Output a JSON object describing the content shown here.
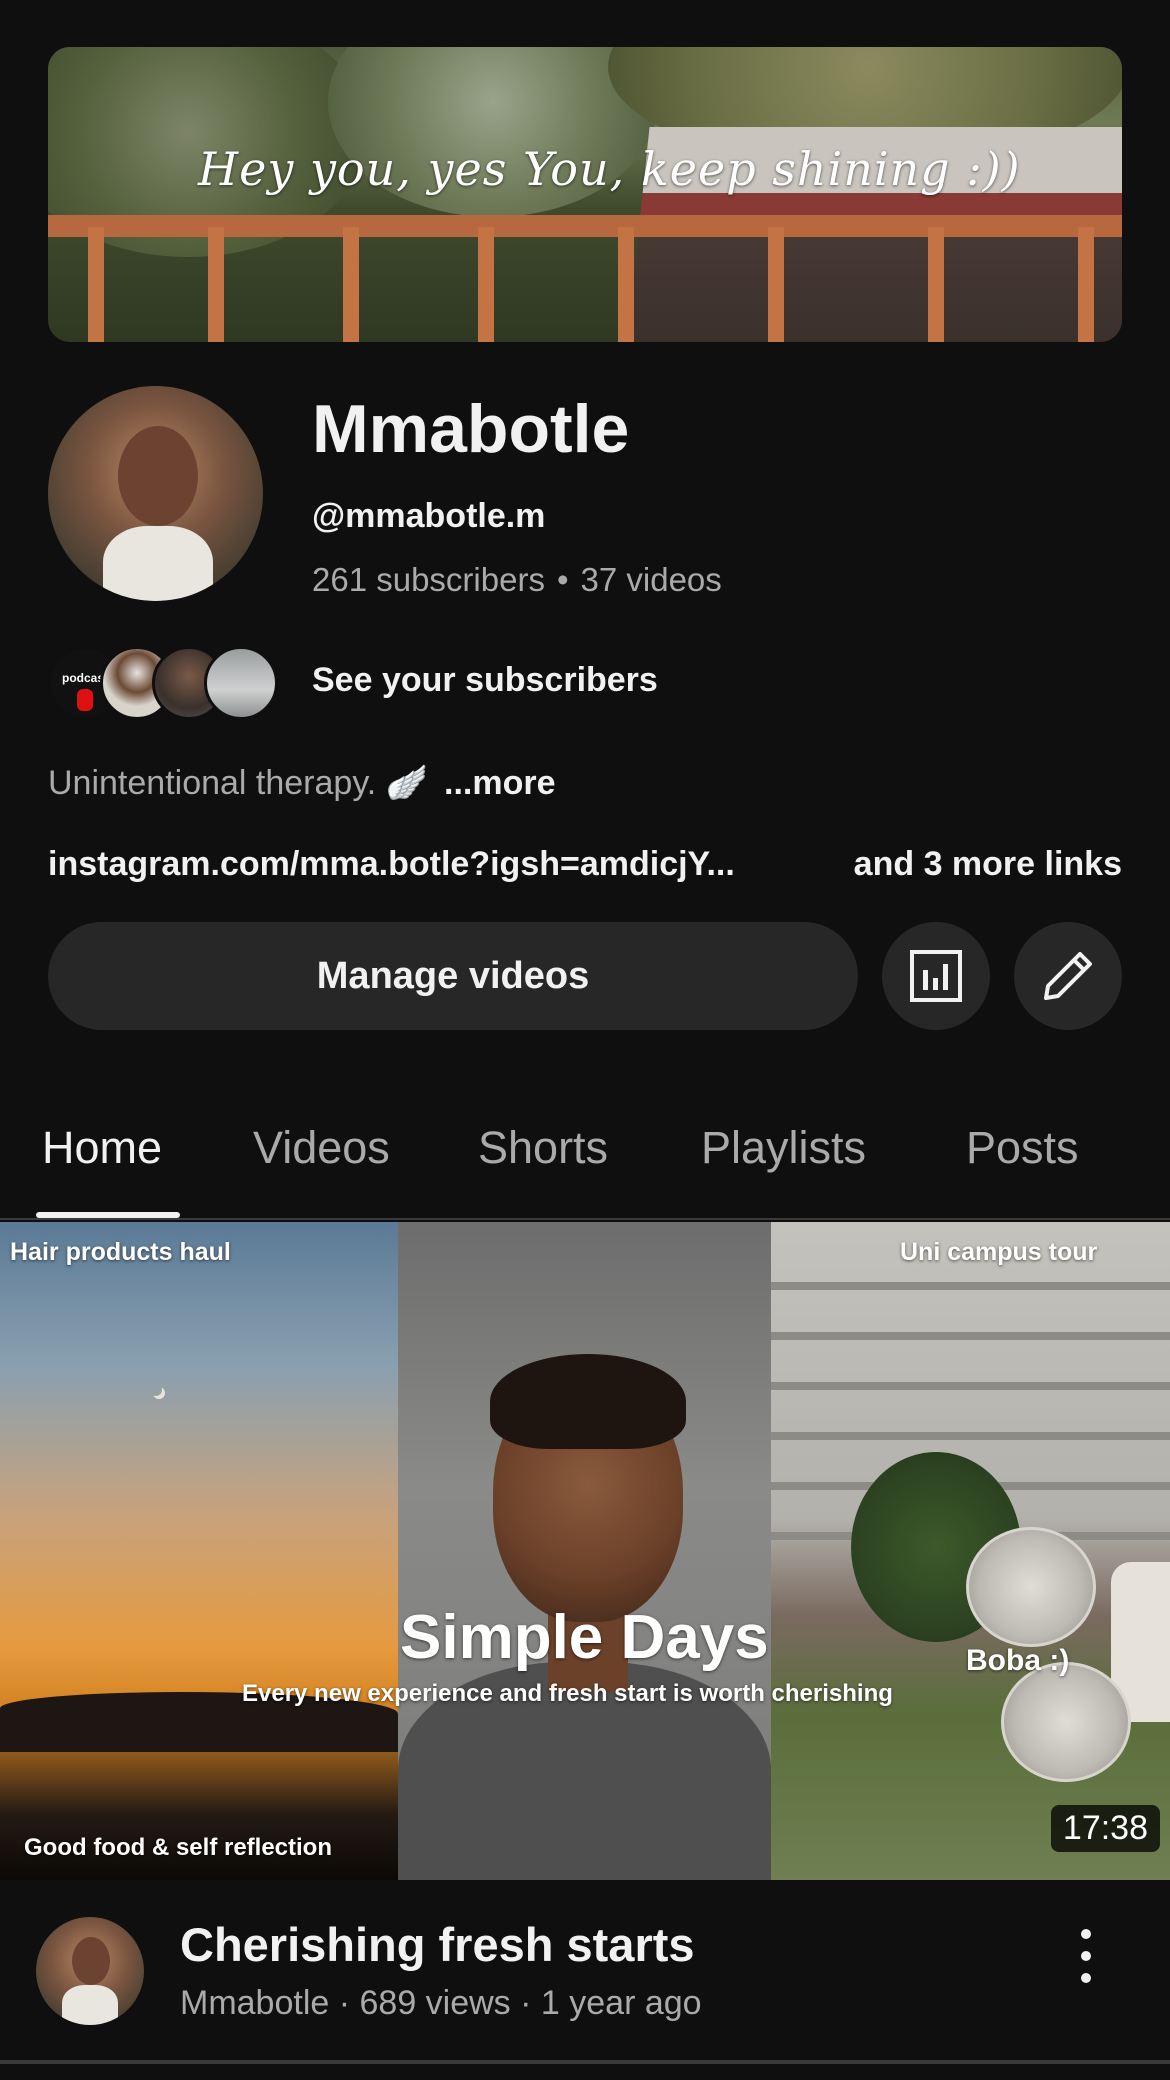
{
  "top_bar": {
    "icons": [
      "back-arrow-icon",
      "cast-icon",
      "search-icon",
      "more-vert-icon"
    ]
  },
  "banner": {
    "text": "Hey you, yes You, keep shining :))"
  },
  "channel": {
    "name": "Mmabotle",
    "handle": "@mmabotle.m",
    "subscribers": "261 subscribers",
    "separator": "•",
    "videos": "37 videos",
    "see_subscribers": "See your subscribers",
    "subscriber_avatar_badge": "podcast",
    "description": "Unintentional therapy. 🪽",
    "description_more": "...more",
    "link": "instagram.com/mma.botle?igsh=amdicjY...",
    "more_links": "and 3 more links"
  },
  "actions": {
    "manage_videos": "Manage videos",
    "analytics_icon": "analytics-icon",
    "edit_icon": "pencil-icon"
  },
  "tabs": [
    {
      "label": "Home",
      "active": true
    },
    {
      "label": "Videos",
      "active": false
    },
    {
      "label": "Shorts",
      "active": false
    },
    {
      "label": "Playlists",
      "active": false
    },
    {
      "label": "Posts",
      "active": false
    }
  ],
  "featured_video": {
    "thumbnail": {
      "top_left": "Hair products haul",
      "bottom_left": "Good food & self reflection",
      "title": "Simple Days",
      "subtitle": "Every new experience and fresh start is worth cherishing",
      "top_right": "Uni campus tour",
      "right_mid": "Boba :)",
      "duration": "17:38"
    },
    "title": "Cherishing fresh starts",
    "meta": "Mmabotle · 689 views · 1 year ago"
  },
  "colors": {
    "background": "#0f0f0f",
    "surface": "#272727",
    "text_primary": "#f1f1f1",
    "text_secondary": "#aaaaaa"
  }
}
